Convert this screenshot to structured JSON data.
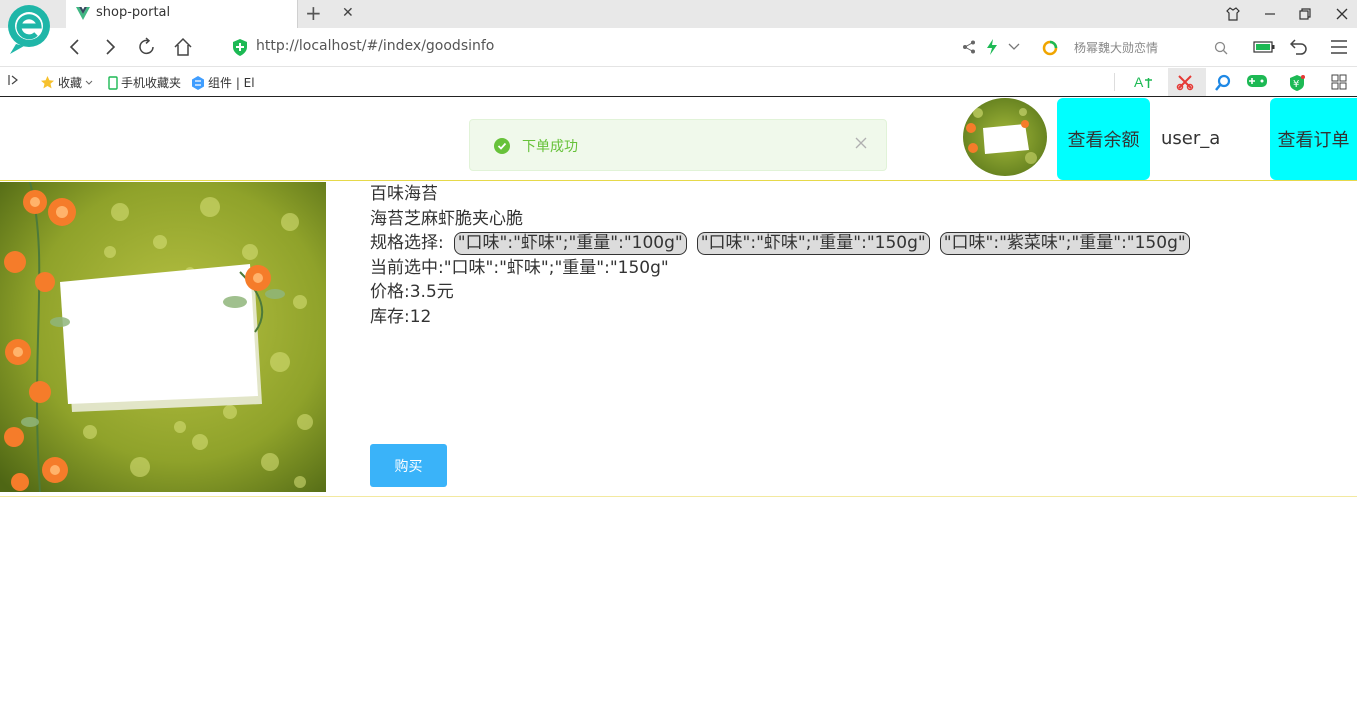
{
  "browser": {
    "tab_title": "shop-portal",
    "url": "http://localhost/#/index/goodsinfo",
    "search_placeholder": "杨幂魏大勋恋情",
    "bookmarks": [
      "收藏",
      "手机收藏夹",
      "组件 | El"
    ]
  },
  "header": {
    "balance_button": "查看余额",
    "username": "user_a",
    "orders_button": "查看订单"
  },
  "toast": {
    "message": "下单成功",
    "type": "success",
    "color": "#67c23a"
  },
  "goods": {
    "name": "百味海苔",
    "description": "海苔芝麻虾脆夹心脆",
    "spec_label": "规格选择:",
    "specs": [
      "\"口味\":\"虾味\";\"重量\":\"100g\"",
      "\"口味\":\"虾味\";\"重量\":\"150g\"",
      "\"口味\":\"紫菜味\";\"重量\":\"150g\""
    ],
    "selected_line": "当前选中:\"口味\":\"虾味\";\"重量\":\"150g\"",
    "price_line": "价格:3.5元",
    "stock_line": "库存:12",
    "buy_button": "购买"
  },
  "colors": {
    "accent_cyan": "#00ffff",
    "buy_blue": "#3ab3f9"
  }
}
